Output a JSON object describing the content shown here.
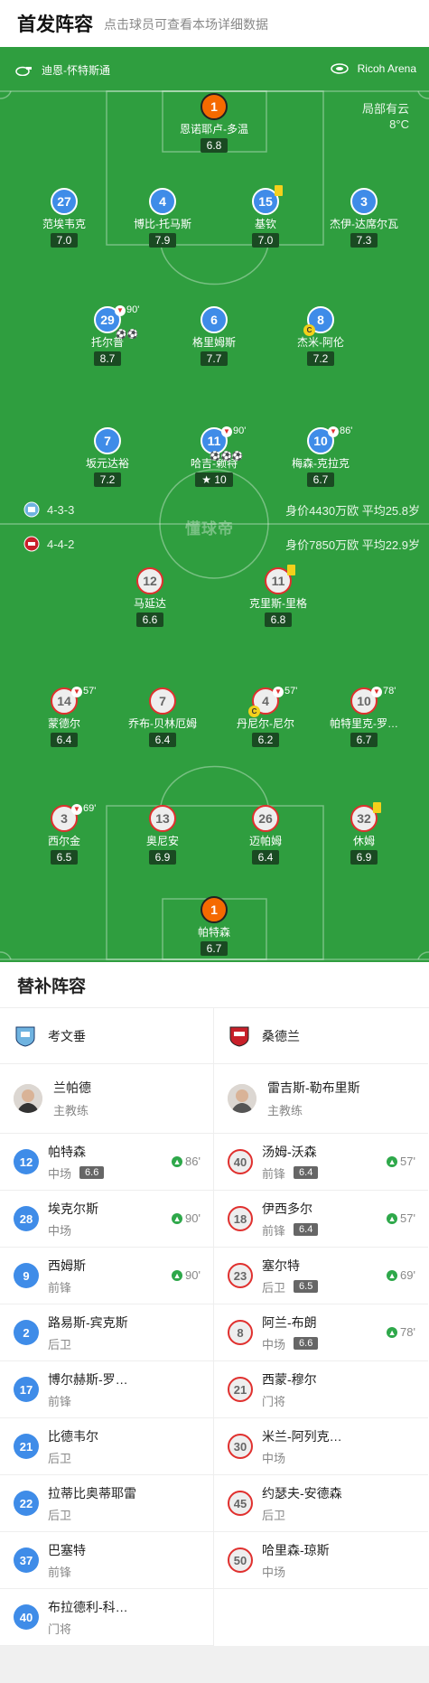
{
  "header": {
    "title": "首发阵容",
    "subtitle": "点击球员可查看本场详细数据"
  },
  "pitch": {
    "home_team": "迪恩-怀特斯通",
    "venue": "Ricoh Arena",
    "weather": "局部有云",
    "temperature": "8°C",
    "watermark": "懂球帝",
    "team_a_formation": "4-3-3",
    "team_a_value": "身价4430万欧 平均25.8岁",
    "team_b_formation": "4-4-2",
    "team_b_value": "身价7850万欧 平均22.9岁",
    "home_players": [
      {
        "num": "1",
        "name": "恩诺耶卢-多温",
        "rating": "6.8",
        "style": "gk"
      },
      {
        "num": "27",
        "name": "范埃韦克",
        "rating": "7.0",
        "style": "blue"
      },
      {
        "num": "4",
        "name": "博比-托马斯",
        "rating": "7.9",
        "style": "blue"
      },
      {
        "num": "15",
        "name": "基钦",
        "rating": "7.0",
        "style": "blue",
        "yellow": true
      },
      {
        "num": "3",
        "name": "杰伊-达席尔瓦",
        "rating": "7.3",
        "style": "blue"
      },
      {
        "num": "29",
        "name": "托尔普",
        "rating": "8.7",
        "style": "blue",
        "sub_min": "90'",
        "balls": "2"
      },
      {
        "num": "6",
        "name": "格里姆斯",
        "rating": "7.7",
        "style": "blue"
      },
      {
        "num": "8",
        "name": "杰米-阿伦",
        "rating": "7.2",
        "style": "blue",
        "captain": "C"
      },
      {
        "num": "7",
        "name": "坂元达裕",
        "rating": "7.2",
        "style": "blue"
      },
      {
        "num": "11",
        "name": "哈吉-赖特",
        "rating": "10",
        "style": "blue",
        "sub_min": "90'",
        "balls": "3",
        "star": true
      },
      {
        "num": "10",
        "name": "梅森-克拉克",
        "rating": "6.7",
        "style": "blue",
        "sub_min": "86'"
      }
    ],
    "away_players": [
      {
        "num": "12",
        "name": "马延达",
        "rating": "6.6",
        "style": "red"
      },
      {
        "num": "11",
        "name": "克里斯-里格",
        "rating": "6.8",
        "style": "red",
        "yellow": true
      },
      {
        "num": "14",
        "name": "蒙德尔",
        "rating": "6.4",
        "style": "red",
        "sub_min": "57'"
      },
      {
        "num": "7",
        "name": "乔布-贝林厄姆",
        "rating": "6.4",
        "style": "red"
      },
      {
        "num": "4",
        "name": "丹尼尔-尼尔",
        "rating": "6.2",
        "style": "red",
        "sub_min": "57'",
        "captain": "C"
      },
      {
        "num": "10",
        "name": "帕特里克-罗…",
        "rating": "6.7",
        "style": "red",
        "sub_min": "78'"
      },
      {
        "num": "3",
        "name": "西尔金",
        "rating": "6.5",
        "style": "red",
        "sub_min": "69'"
      },
      {
        "num": "13",
        "name": "奥尼安",
        "rating": "6.9",
        "style": "red"
      },
      {
        "num": "26",
        "name": "迈帕姆",
        "rating": "6.4",
        "style": "red"
      },
      {
        "num": "32",
        "name": "休姆",
        "rating": "6.9",
        "style": "red",
        "yellow": true
      },
      {
        "num": "1",
        "name": "帕特森",
        "rating": "6.7",
        "style": "gk"
      }
    ]
  },
  "subs": {
    "title": "替补阵容",
    "home": {
      "team": "考文垂",
      "coach": {
        "name": "兰帕德",
        "role": "主教练"
      },
      "players": [
        {
          "num": "12",
          "name": "帕特森",
          "pos": "中场",
          "rating": "6.6",
          "in": "86'"
        },
        {
          "num": "28",
          "name": "埃克尔斯",
          "pos": "中场",
          "in": "90'"
        },
        {
          "num": "9",
          "name": "西姆斯",
          "pos": "前锋",
          "in": "90'"
        },
        {
          "num": "2",
          "name": "路易斯-宾克斯",
          "pos": "后卫"
        },
        {
          "num": "17",
          "name": "博尔赫斯-罗…",
          "pos": "前锋"
        },
        {
          "num": "21",
          "name": "比德韦尔",
          "pos": "后卫"
        },
        {
          "num": "22",
          "name": "拉蒂比奥蒂耶雷",
          "pos": "后卫"
        },
        {
          "num": "37",
          "name": "巴塞特",
          "pos": "前锋"
        },
        {
          "num": "40",
          "name": "布拉德利-科…",
          "pos": "门将"
        }
      ]
    },
    "away": {
      "team": "桑德兰",
      "coach": {
        "name": "雷吉斯-勒布里斯",
        "role": "主教练"
      },
      "players": [
        {
          "num": "40",
          "name": "汤姆-沃森",
          "pos": "前锋",
          "rating": "6.4",
          "in": "57'"
        },
        {
          "num": "18",
          "name": "伊西多尔",
          "pos": "前锋",
          "rating": "6.4",
          "in": "57'"
        },
        {
          "num": "23",
          "name": "塞尔特",
          "pos": "后卫",
          "rating": "6.5",
          "in": "69'"
        },
        {
          "num": "8",
          "name": "阿兰-布朗",
          "pos": "中场",
          "rating": "6.6",
          "in": "78'"
        },
        {
          "num": "21",
          "name": "西蒙-穆尔",
          "pos": "门将"
        },
        {
          "num": "30",
          "name": "米兰-阿列克…",
          "pos": "中场"
        },
        {
          "num": "45",
          "name": "约瑟夫-安德森",
          "pos": "后卫"
        },
        {
          "num": "50",
          "name": "哈里森-琼斯",
          "pos": "中场"
        }
      ]
    }
  },
  "colors": {
    "pitch": "#2f9e3f",
    "home": "#3f8ce8",
    "away_ring": "#e0302e",
    "gk": "#f56a00",
    "sub_arrow": "#2ea84a"
  }
}
